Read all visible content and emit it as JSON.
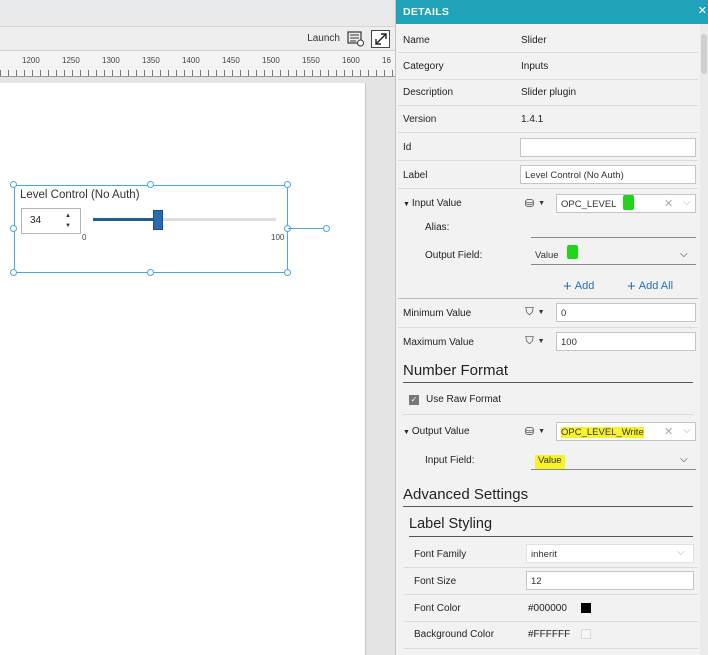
{
  "toolbar": {
    "launch_label": "Launch"
  },
  "ruler": {
    "labels": [
      "1200",
      "1250",
      "1300",
      "1350",
      "1400",
      "1450",
      "1500",
      "1550",
      "1600",
      "16"
    ]
  },
  "widget": {
    "label": "Level Control (No Auth)",
    "value": "34",
    "min": "0",
    "max": "100",
    "level": 0.34
  },
  "panel": {
    "title": "DETAILS",
    "name_label": "Name",
    "name_value": "Slider",
    "category_label": "Category",
    "category_value": "Inputs",
    "description_label": "Description",
    "description_value": "Slider plugin",
    "version_label": "Version",
    "version_value": "1.4.1",
    "id_label": "Id",
    "id_value": "",
    "label_label": "Label",
    "label_value": "Level Control (No Auth)",
    "input_value": {
      "label": "Input Value",
      "tag": "OPC_LEVEL",
      "alias_label": "Alias:",
      "alias_value": "",
      "output_field_label": "Output Field:",
      "output_field_value": "Value",
      "add_label": "Add",
      "add_all_label": "Add All"
    },
    "minimum_label": "Minimum Value",
    "minimum_value": "0",
    "maximum_label": "Maximum Value",
    "maximum_value": "100",
    "number_format_title": "Number Format",
    "use_raw_format_label": "Use Raw Format",
    "output_value": {
      "label": "Output Value",
      "tag": "OPC_LEVEL_Write",
      "input_field_label": "Input Field:",
      "input_field_value": "Value"
    },
    "advanced_title": "Advanced Settings",
    "label_styling_title": "Label Styling",
    "font_family_label": "Font Family",
    "font_family_value": "inherit",
    "font_size_label": "Font Size",
    "font_size_value": "12",
    "font_color_label": "Font Color",
    "font_color_value": "#000000",
    "bg_color_label": "Background Color",
    "bg_color_value": "#FFFFFF"
  },
  "colors": {
    "header": "#1fa3b8",
    "selection": "#4aa8dc",
    "slider": "#2a6bb0",
    "highlight": "#f8f22a",
    "marker": "#22d31c"
  },
  "icons": {
    "launch": "launch-settings-icon",
    "expand": "expand-icon",
    "close": "close-icon",
    "binding": "data-binding-icon",
    "paint": "paint-bucket-icon"
  }
}
